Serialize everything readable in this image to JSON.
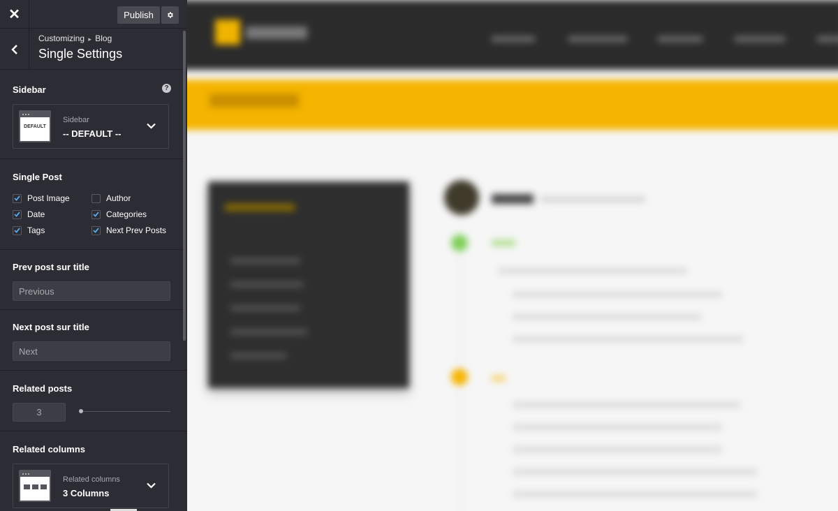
{
  "topbar": {
    "close_glyph": "✕",
    "publish_label": "Publish",
    "settings_icon": "gear-icon"
  },
  "header": {
    "breadcrumb_root": "Customizing",
    "breadcrumb_sep": "▸",
    "breadcrumb_section": "Blog",
    "title": "Single Settings"
  },
  "sidebar_section": {
    "label": "Sidebar",
    "help_glyph": "?",
    "select": {
      "label": "Sidebar",
      "value": "-- DEFAULT --",
      "thumb_text": "DEFAULT"
    }
  },
  "single_post": {
    "label": "Single Post",
    "options": [
      {
        "label": "Post Image",
        "checked": true
      },
      {
        "label": "Author",
        "checked": false
      },
      {
        "label": "Date",
        "checked": true
      },
      {
        "label": "Categories",
        "checked": true
      },
      {
        "label": "Tags",
        "checked": true
      },
      {
        "label": "Next Prev Posts",
        "checked": true
      }
    ]
  },
  "prev_post": {
    "label": "Prev post sur title",
    "value": "Previous"
  },
  "next_post": {
    "label": "Next post sur title",
    "value": "Next"
  },
  "related_posts": {
    "label": "Related posts",
    "value": "3"
  },
  "related_columns": {
    "label": "Related columns",
    "select_label": "Related columns",
    "value": "3 Columns"
  },
  "colors": {
    "panel_bg": "#2c2c34",
    "accent_check": "#5aa9e6",
    "preview_accent": "#f5b400"
  }
}
